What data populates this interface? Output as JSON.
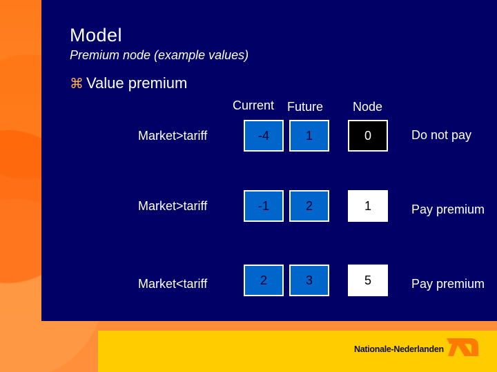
{
  "slide": {
    "title": "Model",
    "subtitle": "Premium node (example values)",
    "bullet_icon": "command-bullet-icon",
    "bullet_text": "Value premium"
  },
  "table": {
    "headers": {
      "current": "Current",
      "future": "Future",
      "node": "Node"
    },
    "rows": [
      {
        "label": "Market>tariff",
        "current": "-4",
        "future": "1",
        "node": "0",
        "node_style": "black",
        "decision": "Do not pay"
      },
      {
        "label": "Market>tariff",
        "current": "-1",
        "future": "2",
        "node": "1",
        "node_style": "white",
        "decision": "Pay premium"
      },
      {
        "label": "Market<tariff",
        "current": "2",
        "future": "3",
        "node": "5",
        "node_style": "white",
        "decision": "Pay premium"
      }
    ]
  },
  "footer": {
    "brand_name": "Nationale-Nederlanden",
    "logo_icon": "nn-logo-icon"
  },
  "colors": {
    "navy": "#000066",
    "cell_blue": "#0066cc",
    "orange": "#ff8a2e",
    "yellow": "#ffcc00",
    "logo_orange": "#ff7a00"
  }
}
